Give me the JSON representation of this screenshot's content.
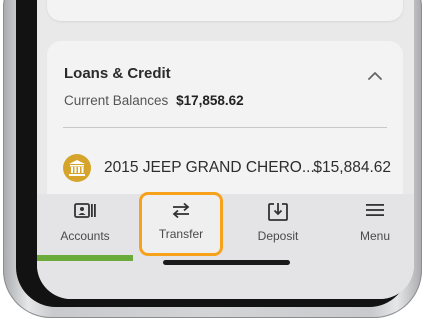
{
  "loans": {
    "title": "Loans & Credit",
    "balance_label": "Current Balances",
    "balance_value": "$17,858.62",
    "items": [
      {
        "name": "2015 JEEP GRAND CHERO...",
        "amount": "$15,884.62",
        "icon": "bank-icon"
      }
    ]
  },
  "tabbar": {
    "tabs": [
      {
        "label": "Accounts",
        "icon": "accounts-icon",
        "active": true
      },
      {
        "label": "Transfer",
        "icon": "transfer-arrows-icon",
        "highlighted": true
      },
      {
        "label": "Deposit",
        "icon": "deposit-icon"
      },
      {
        "label": "Menu",
        "icon": "hamburger-icon"
      }
    ]
  },
  "colors": {
    "accent_green": "#6aab3a",
    "highlight_orange": "#f7a21b",
    "loan_icon_gold": "#d6a42b"
  }
}
